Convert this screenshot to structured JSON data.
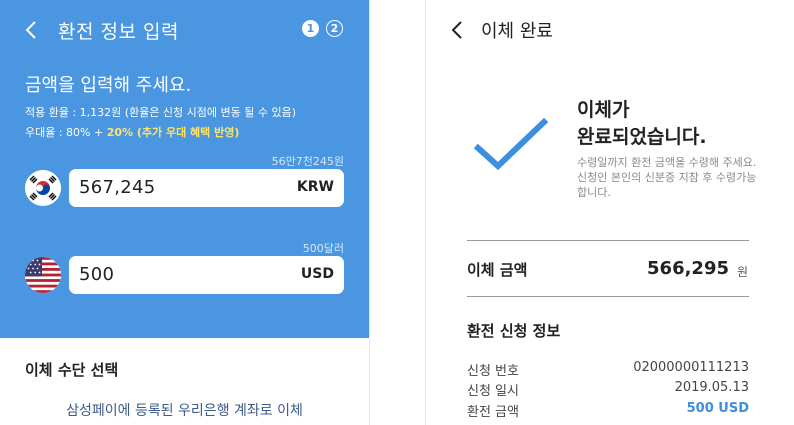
{
  "left_screen": {
    "title": "환전 정보 입력",
    "steps": [
      "1",
      "2"
    ],
    "heading": "금액을 입력해 주세요.",
    "rate_line": "적용 환율 : 1,132원 (환율은 신청 시점에 변동 될 수 있음)",
    "pref_prefix": "우대율 : 80% + ",
    "pref_highlight": "20% (추가 우대 혜택 반영)",
    "krw": {
      "hint": "56만7천245원",
      "value": "567,245",
      "currency": "KRW"
    },
    "usd": {
      "hint": "500달러",
      "value": "500",
      "currency": "USD"
    },
    "method_title": "이체 수단 선택",
    "method_link": "삼성페이에 등록된 우리은행 계좌로 이체"
  },
  "right_screen": {
    "title": "이체 완료",
    "done_line1": "이체가",
    "done_line2": "완료되었습니다.",
    "done_desc": "수령일까지 환전 금액을 수령해 주세요. 신청인 본인의 신분증 지참 후 수령가능합니다.",
    "amount_label": "이체 금액",
    "amount_value": "566,295",
    "amount_unit": "원",
    "info_title": "환전 신청 정보",
    "info_rows": [
      {
        "label": "신청 번호",
        "value": "02000000111213"
      },
      {
        "label": "신청 일시",
        "value": "2019.05.13"
      },
      {
        "label": "환전 금액",
        "value": "500 USD"
      }
    ]
  },
  "colors": {
    "primary_blue": "#4a96e0",
    "highlight_yellow": "#ffe46b",
    "check_blue": "#3b8ee0"
  },
  "icons": {
    "back": "chevron-left-icon",
    "korea_flag": "korea-flag-icon",
    "us_flag": "us-flag-icon",
    "check": "checkmark-icon"
  }
}
